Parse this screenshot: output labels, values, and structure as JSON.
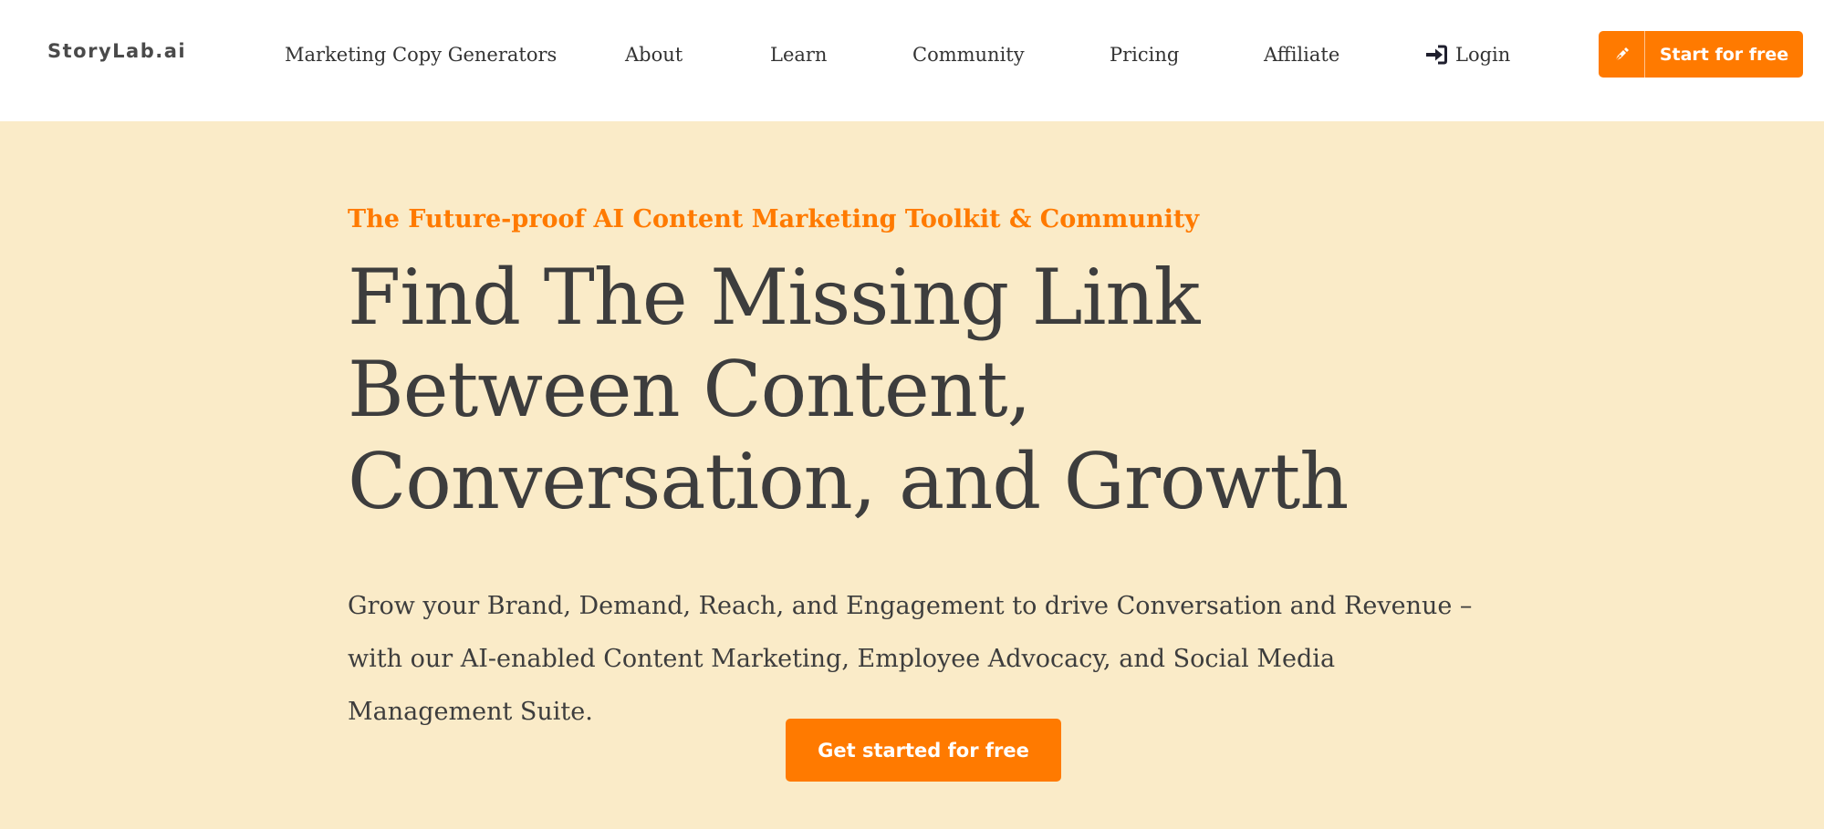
{
  "brand": {
    "logo_text": "StoryLab.ai"
  },
  "nav": {
    "items": [
      {
        "label": "Marketing Copy Generators"
      },
      {
        "label": "About"
      },
      {
        "label": "Learn"
      },
      {
        "label": "Community"
      },
      {
        "label": "Pricing"
      },
      {
        "label": "Affiliate"
      }
    ],
    "login": {
      "label": "Login",
      "icon": "sign-in-icon"
    },
    "cta": {
      "label": "Start for free",
      "icon": "pen-icon"
    }
  },
  "hero": {
    "eyebrow": "The Future-proof AI Content Marketing Toolkit & Community",
    "headline": "Find The Missing Link Between Content, Conversation, and Growth",
    "subtext": "Grow your Brand, Demand, Reach, and Engagement to drive Conversation and Revenue – with our AI-enabled Content Marketing, Employee Advocacy, and Social Media Management Suite.",
    "cta_label": "Get started for free"
  },
  "colors": {
    "accent": "#ff7a00",
    "hero_background": "#faebc8",
    "text": "#3d3d3d"
  }
}
